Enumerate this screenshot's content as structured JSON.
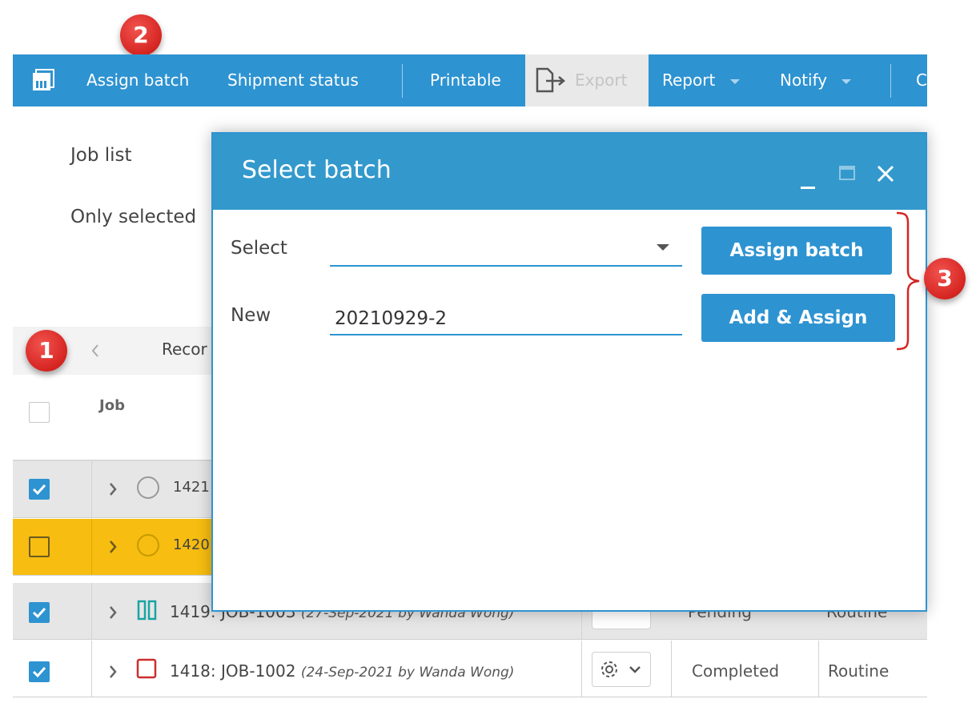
{
  "toolbar": {
    "items": [
      {
        "label": "Assign batch"
      },
      {
        "label": "Shipment status"
      },
      {
        "label": "Printable"
      },
      {
        "label": "Export"
      },
      {
        "label": "Report"
      },
      {
        "label": "Notify"
      }
    ],
    "cut_label": "C"
  },
  "filter": {
    "job_list_label": "Job list",
    "only_selected_label": "Only selected"
  },
  "pager": {
    "records_label": "Recor"
  },
  "grid": {
    "columns": [
      "Job"
    ],
    "rows": [
      {
        "checked": true,
        "status_icon": "circle-icon",
        "id": "1421",
        "date_note": "",
        "status": "",
        "priority": ""
      },
      {
        "checked": false,
        "status_icon": "circle-icon",
        "id": "1420",
        "date_note": "",
        "status": "",
        "priority": ""
      },
      {
        "checked": true,
        "status_icon": "pause-icon",
        "id": "1419: JOB-1003",
        "date_note": "(27-Sep-2021 by Wanda Wong)",
        "status": "Pending",
        "priority": "Routine"
      },
      {
        "checked": true,
        "status_icon": "square-icon",
        "id": "1418: JOB-1002",
        "date_note": "(24-Sep-2021 by Wanda Wong)",
        "status": "Completed",
        "priority": "Routine"
      }
    ]
  },
  "dialog": {
    "title": "Select batch",
    "select_label": "Select",
    "select_value": "",
    "new_label": "New",
    "new_value": "20210929-2",
    "assign_button": "Assign batch",
    "add_assign_button": "Add & Assign"
  },
  "callouts": [
    "1",
    "2",
    "3"
  ],
  "colors": {
    "accent": "#2e93d1",
    "dialog_header": "#3399cc",
    "highlight_row": "#f7bd10",
    "callout": "#d52521"
  }
}
